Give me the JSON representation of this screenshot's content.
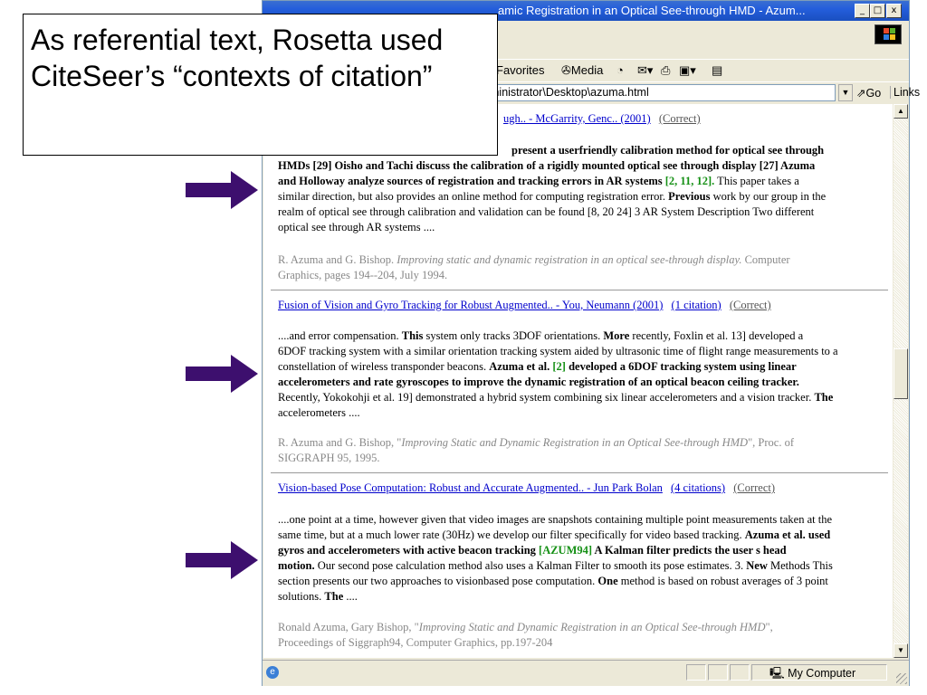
{
  "window": {
    "title": "amic Registration in an Optical See-through HMD - Azum...",
    "min_label": "_",
    "max_label": "□",
    "close_label": "x"
  },
  "toolbar": {
    "favorites": "Favorites",
    "media": "Media"
  },
  "address": {
    "value": "ministrator\\Desktop\\azuma.html",
    "go": "Go",
    "links": "Links"
  },
  "callout": {
    "text": "As referential text, Rosetta used CiteSeer’s “contexts of citation”"
  },
  "entries": [
    {
      "link": "ugh.. - McGarrity, Genc.. (2001)",
      "correct": "(Correct)",
      "para_html": "present a userfriendly calibration method for optical see through HMDs [29] Oisho and Tachi discuss the calibration of a rigidly mounted optical see through display [27] Azuma and Holloway analyze sources of registration and tracking errors in AR systems",
      "para_line1": "present a userfriendly calibration method for optical see through",
      "para_line2": "HMDs [29] Oisho and Tachi discuss the calibration of a rigidly mounted optical see through display [27] Azuma",
      "para_line3a": "and Holloway analyze sources of registration and tracking errors in AR systems ",
      "para_line3b": "[2, 11, 12].",
      "para_line3c": " This paper takes a",
      "para_line4": "similar direction, but also provides an online method for computing registration error. ",
      "para_line4b": "Previous",
      "para_line4c": " work by our group in the",
      "para_line5": "realm of optical see through calibration and validation can be found [8, 20 24] 3 AR System Description Two different",
      "para_line6": "optical see through AR systems ....",
      "ref_line1a": "R. Azuma and G. Bishop. ",
      "ref_line1b": "Improving static and dynamic registration in an optical see-through display.",
      "ref_line1c": " Computer",
      "ref_line2": "Graphics, pages 194--204, July 1994."
    },
    {
      "link": "Fusion of Vision and Gyro Tracking for Robust Augmented.. - You, Neumann (2001)",
      "citations": "(1 citation)",
      "correct": "(Correct)",
      "l1a": "....and error compensation. ",
      "l1b": "This",
      "l1c": " system only tracks 3DOF orientations. ",
      "l1d": "More",
      "l1e": " recently, Foxlin et al. 13] developed a",
      "l2": "6DOF tracking system with a similar orientation tracking system aided by ultrasonic time of flight range measurements to a",
      "l3a": "constellation of wireless transponder beacons. ",
      "l3b": "Azuma et al. ",
      "l3c": "[2]",
      "l3d": " developed a 6DOF tracking system using linear",
      "l4": "accelerometers and rate gyroscopes to improve the dynamic registration of an optical beacon ceiling tracker.",
      "l5a": "Recently, Yokokohji et al. 19] demonstrated a hybrid system combining six linear accelerometers and a vision tracker. ",
      "l5b": "The",
      "l6": "accelerometers ....",
      "ref_line1a": "R. Azuma and G. Bishop, \"",
      "ref_line1b": "Improving Static and Dynamic Registration in an Optical See-through HMD",
      "ref_line1c": "\", Proc. of",
      "ref_line2": "SIGGRAPH 95, 1995."
    },
    {
      "link": "Vision-based Pose Computation: Robust and Accurate Augmented.. - Jun Park Bolan",
      "citations": "(4 citations)",
      "correct": "(Correct)",
      "l1": "....one point at a time, however given that video images are snapshots containing multiple point measurements taken at the",
      "l2a": "same time, but at a much lower rate (30Hz) we develop our filter specifically for video based tracking. ",
      "l2b": "Azuma et al. used",
      "l3a": "gyros and accelerometers with active beacon tracking ",
      "l3b": "[AZUM94]",
      "l3c": " A Kalman filter predicts the user s head",
      "l4a": "motion.",
      "l4b": " Our second pose calculation method also uses a Kalman Filter to smooth its pose estimates. 3. ",
      "l4c": "New",
      "l4d": " Methods This",
      "l5a": "section presents our two approaches to visionbased pose computation. ",
      "l5b": "One",
      "l5c": " method is based on robust averages of 3 point",
      "l6a": "solutions. ",
      "l6b": "The",
      "l6c": " ....",
      "ref_line1a": "Ronald Azuma, Gary Bishop, \"",
      "ref_line1b": "Improving Static and Dynamic Registration in an Optical See-through HMD",
      "ref_line1c": "\",",
      "ref_line2": "Proceedings of Siggraph94, Computer Graphics, pp.197-204"
    }
  ],
  "status": {
    "zone": "My Computer"
  },
  "colors": {
    "arrow": "#3d0f6e",
    "link": "#0000cc",
    "citation_green": "#159015",
    "titlebar": "#245edb"
  }
}
